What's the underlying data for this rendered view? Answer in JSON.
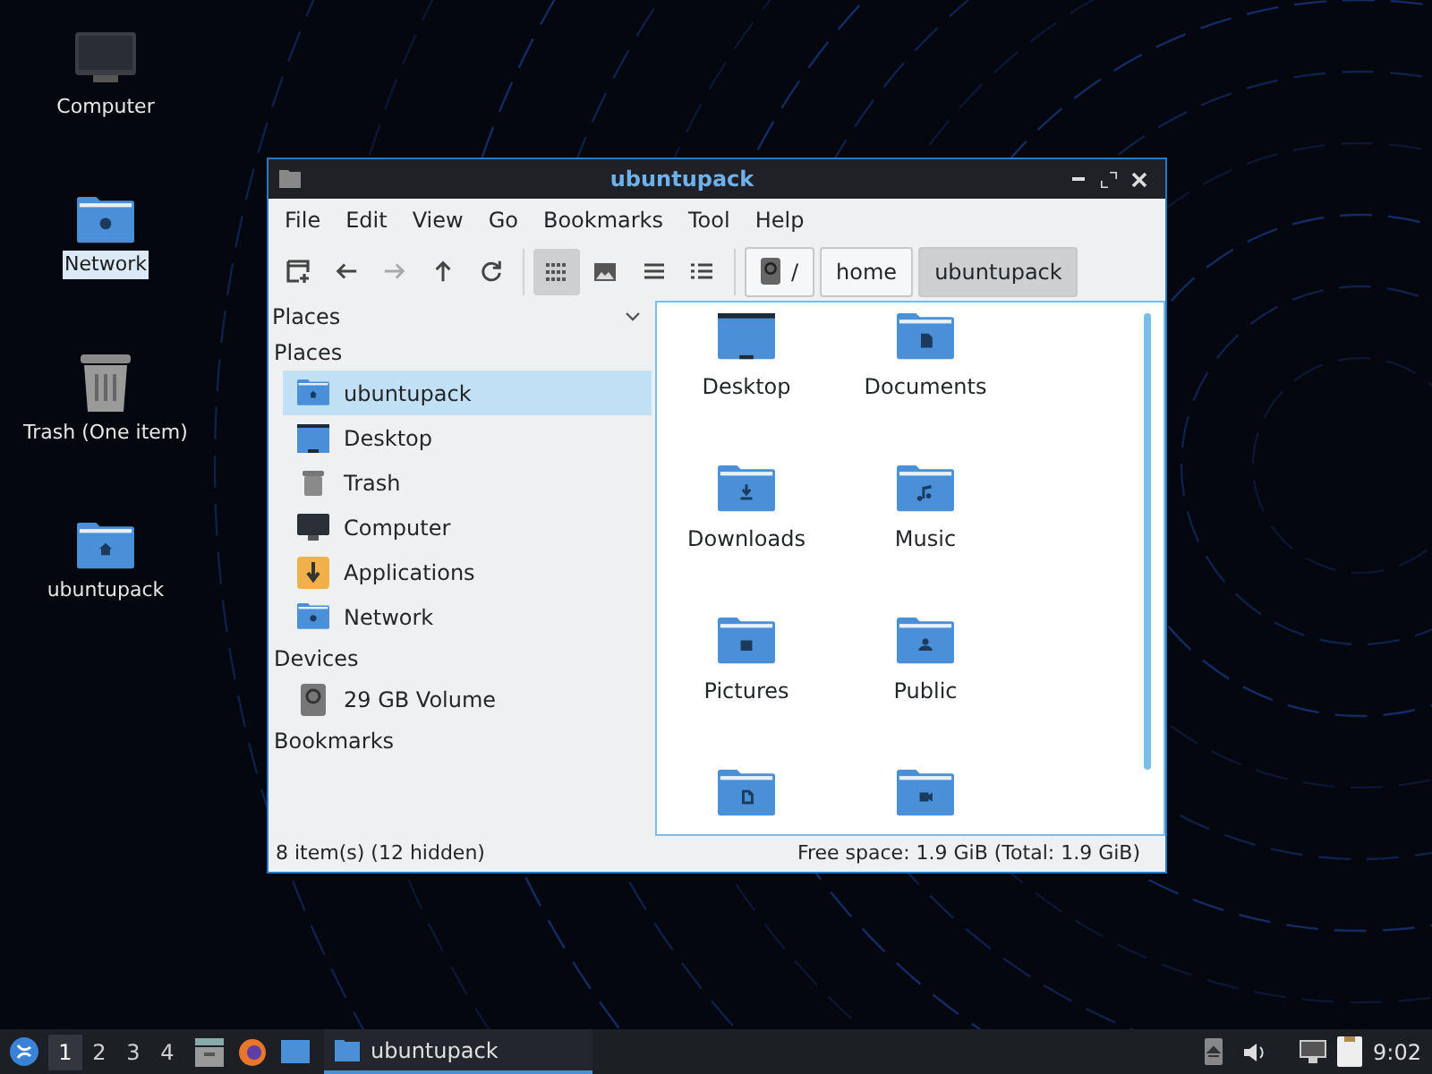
{
  "desktop_icons": [
    {
      "kind": "computer",
      "label": "Computer",
      "selected": false
    },
    {
      "kind": "network",
      "label": "Network",
      "selected": true
    },
    {
      "kind": "trash",
      "label": "Trash (One item)",
      "selected": false
    },
    {
      "kind": "home",
      "label": "ubuntupack",
      "selected": false
    }
  ],
  "window": {
    "title": "ubuntupack",
    "menu": [
      "File",
      "Edit",
      "View",
      "Go",
      "Bookmarks",
      "Tool",
      "Help"
    ],
    "toolbar": {
      "view_modes": [
        {
          "kind": "icons",
          "selected": true
        },
        {
          "kind": "thumbnails",
          "selected": false
        },
        {
          "kind": "compact",
          "selected": false
        },
        {
          "kind": "list",
          "selected": false
        }
      ],
      "path": [
        {
          "kind": "root",
          "label": "/",
          "selected": false
        },
        {
          "kind": "folder",
          "label": "home",
          "selected": false
        },
        {
          "kind": "folder",
          "label": "ubuntupack",
          "selected": true
        }
      ]
    },
    "sidebar": {
      "header": "Places",
      "sections": [
        {
          "title": "Places",
          "items": [
            {
              "kind": "home",
              "label": "ubuntupack",
              "selected": true
            },
            {
              "kind": "desktop",
              "label": "Desktop",
              "selected": false
            },
            {
              "kind": "trash",
              "label": "Trash",
              "selected": false
            },
            {
              "kind": "computer",
              "label": "Computer",
              "selected": false
            },
            {
              "kind": "applications",
              "label": "Applications",
              "selected": false
            },
            {
              "kind": "network",
              "label": "Network",
              "selected": false
            }
          ]
        },
        {
          "title": "Devices",
          "items": [
            {
              "kind": "drive",
              "label": "29 GB Volume",
              "selected": false
            }
          ]
        },
        {
          "title": "Bookmarks"
        }
      ]
    },
    "files": [
      {
        "kind": "desktop",
        "label": "Desktop"
      },
      {
        "kind": "document",
        "label": "Documents"
      },
      {
        "kind": "download",
        "label": "Downloads"
      },
      {
        "kind": "music",
        "label": "Music"
      },
      {
        "kind": "picture",
        "label": "Pictures"
      },
      {
        "kind": "public",
        "label": "Public"
      },
      {
        "kind": "template"
      },
      {
        "kind": "video"
      }
    ],
    "status": {
      "items": "8 item(s) (12 hidden)",
      "free_space": "Free space: 1.9 GiB (Total: 1.9 GiB)"
    }
  },
  "taskbar": {
    "workspaces": [
      {
        "label": "1",
        "selected": true
      },
      {
        "label": "2",
        "selected": false
      },
      {
        "label": "3",
        "selected": false
      },
      {
        "label": "4",
        "selected": false
      }
    ],
    "task": {
      "label": "ubuntupack",
      "active": true
    },
    "clock": "9:02"
  }
}
